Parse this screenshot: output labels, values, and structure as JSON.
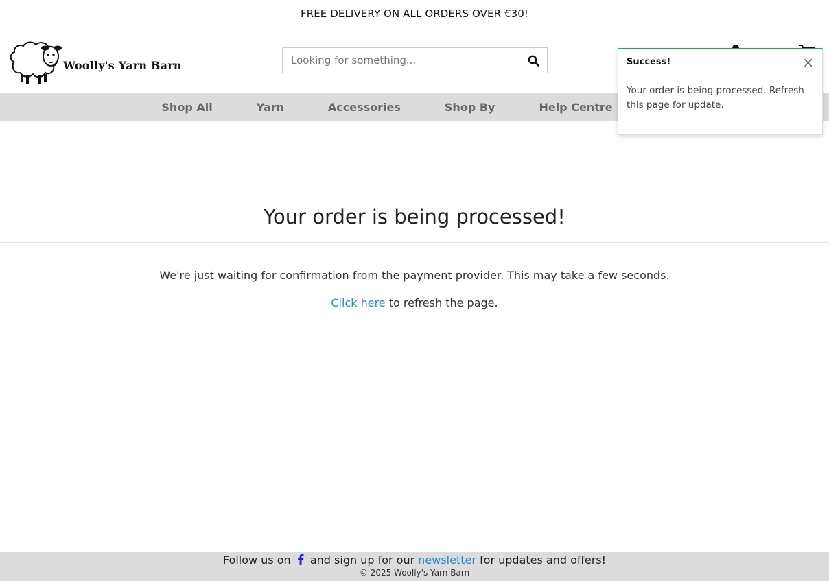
{
  "promo": {
    "text": "FREE DELIVERY ON ALL ORDERS OVER €30!"
  },
  "header": {
    "logo_text": "Woolly's Yarn Barn",
    "search_placeholder": "Looking for something..."
  },
  "nav": {
    "items": [
      {
        "label": "Shop All"
      },
      {
        "label": "Yarn"
      },
      {
        "label": "Accessories"
      },
      {
        "label": "Shop By"
      },
      {
        "label": "Help Centre"
      }
    ]
  },
  "main": {
    "title": "Your order is being processed!",
    "message": "We're just waiting for confirmation from the payment provider. This may take a few seconds.",
    "refresh_link": "Click here",
    "refresh_rest": " to refresh the page."
  },
  "footer": {
    "follow_prefix": "Follow us on ",
    "follow_middle": " and sign up for our ",
    "newsletter_link": "newsletter",
    "follow_suffix": " for updates and offers!",
    "copyright": "© 2025 Woolly's Yarn Barn"
  },
  "toast": {
    "title": "Success!",
    "close": "×",
    "body": "Your order is being processed. Refresh this page for update."
  },
  "colors": {
    "link": "#2a87d0",
    "nav_bg": "#dcdcdc",
    "success": "#28a745",
    "facebook": "#1a1aff"
  }
}
